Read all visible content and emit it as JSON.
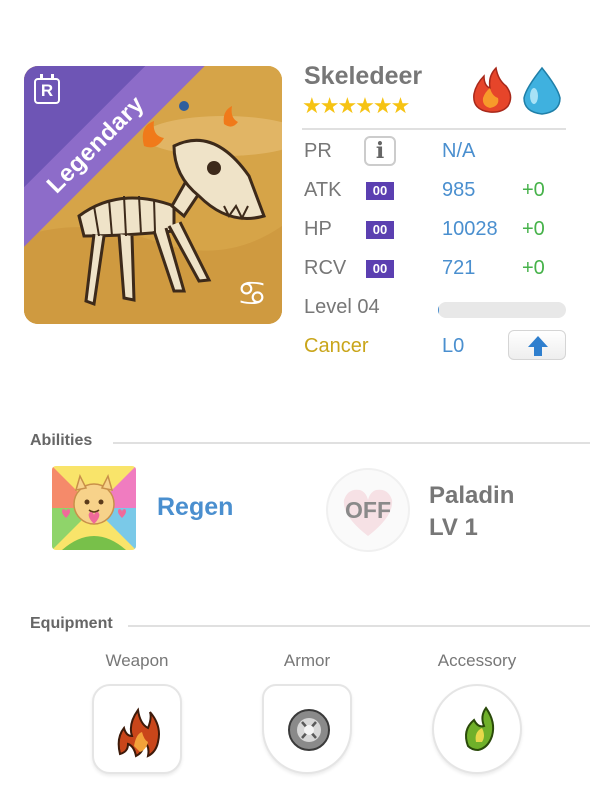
{
  "monster": {
    "name": "Skeledeer",
    "rarity": "Legendary",
    "rarity_badge": "R",
    "stars": "★★★★★★",
    "zodiac_symbol": "♋",
    "elements": [
      "fire-element-icon",
      "water-element-icon"
    ]
  },
  "stats": {
    "pr": {
      "label": "PR",
      "value": "N/A"
    },
    "atk": {
      "label": "ATK",
      "badge": "00",
      "value": "985",
      "bonus": "+0"
    },
    "hp": {
      "label": "HP",
      "badge": "00",
      "value": "10028",
      "bonus": "+0"
    },
    "rcv": {
      "label": "RCV",
      "badge": "00",
      "value": "721",
      "bonus": "+0"
    },
    "level": {
      "label": "Level 04",
      "progress": 0.01
    },
    "sign": {
      "label": "Cancer",
      "value": "L0"
    }
  },
  "abilities": {
    "title": "Abilities",
    "active": {
      "name": "Regen"
    },
    "passive": {
      "toggle": "OFF",
      "name": "Paladin",
      "level": "LV 1"
    }
  },
  "equipment": {
    "title": "Equipment",
    "slots": [
      {
        "label": "Weapon",
        "icon": "weapon-flame-icon"
      },
      {
        "label": "Armor",
        "icon": "armor-shield-icon"
      },
      {
        "label": "Accessory",
        "icon": "accessory-leaf-icon"
      }
    ]
  },
  "colors": {
    "accent_blue": "#4a8fcf",
    "bonus_green": "#46b24a",
    "rarity_purple": "#8d6cc9",
    "star_gold": "#f6c313",
    "sign_gold": "#c9a51a"
  }
}
